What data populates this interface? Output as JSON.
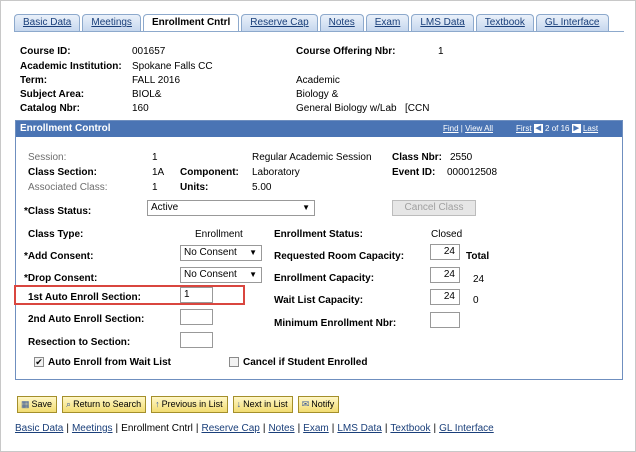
{
  "tabs": [
    "Basic Data",
    "Meetings",
    "Enrollment Cntrl",
    "Reserve Cap",
    "Notes",
    "Exam",
    "LMS Data",
    "Textbook",
    "GL Interface"
  ],
  "active_tab": "Enrollment Cntrl",
  "header": {
    "course_id_label": "Course ID:",
    "course_id": "001657",
    "offering_label": "Course Offering Nbr:",
    "offering": "1",
    "institution_label": "Academic Institution:",
    "institution": "Spokane Falls CC",
    "term_label": "Term:",
    "term": "FALL 2016",
    "term_desc": "Academic",
    "subject_label": "Subject Area:",
    "subject": "BIOL&",
    "subject_desc": "Biology &",
    "catalog_label": "Catalog Nbr:",
    "catalog": "160",
    "catalog_desc": "General Biology w/Lab",
    "catalog_extra": "[CCN"
  },
  "panel": {
    "title": "Enrollment Control",
    "find": "Find",
    "view_all": "View All",
    "first": "First",
    "prev_icon": "◀",
    "counter": "2 of 16",
    "next_icon": "▶",
    "last": "Last"
  },
  "fields": {
    "session_label": "Session:",
    "session": "1",
    "session_desc": "Regular Academic Session",
    "class_nbr_label": "Class Nbr:",
    "class_nbr": "2550",
    "class_section_label": "Class Section:",
    "class_section": "1A",
    "component_label": "Component:",
    "component": "Laboratory",
    "event_id_label": "Event ID:",
    "event_id": "000012508",
    "assoc_class_label": "Associated Class:",
    "assoc_class": "1",
    "units_label": "Units:",
    "units": "5.00",
    "class_status_label": "*Class Status:",
    "class_status": "Active",
    "cancel_class": "Cancel Class",
    "class_type_label": "Class Type:",
    "class_type": "Enrollment",
    "enroll_status_label": "Enrollment Status:",
    "enroll_status": "Closed",
    "add_consent_label": "*Add Consent:",
    "add_consent": "No Consent",
    "req_room_label": "Requested Room Capacity:",
    "req_room": "24",
    "total_label": "Total",
    "drop_consent_label": "*Drop Consent:",
    "drop_consent": "No Consent",
    "enroll_cap_label": "Enrollment Capacity:",
    "enroll_cap": "24",
    "enroll_total": "24",
    "auto1_label": "1st Auto Enroll Section:",
    "auto1": "1",
    "wait_cap_label": "Wait List Capacity:",
    "wait_cap": "24",
    "wait_total": "0",
    "auto2_label": "2nd Auto Enroll Section:",
    "auto2": "",
    "min_enroll_label": "Minimum Enrollment Nbr:",
    "min_enroll": "",
    "resection_label": "Resection to Section:",
    "resection": "",
    "auto_wait_label": "Auto Enroll from Wait List",
    "cancel_enrolled_label": "Cancel if Student Enrolled"
  },
  "toolbar": {
    "save": "Save",
    "return": "Return to Search",
    "previous": "Previous in List",
    "next": "Next in List",
    "notify": "Notify"
  },
  "colors": {
    "panel_header": "#4a74b4",
    "highlight": "#d9463f",
    "link": "#1a3f7a"
  }
}
